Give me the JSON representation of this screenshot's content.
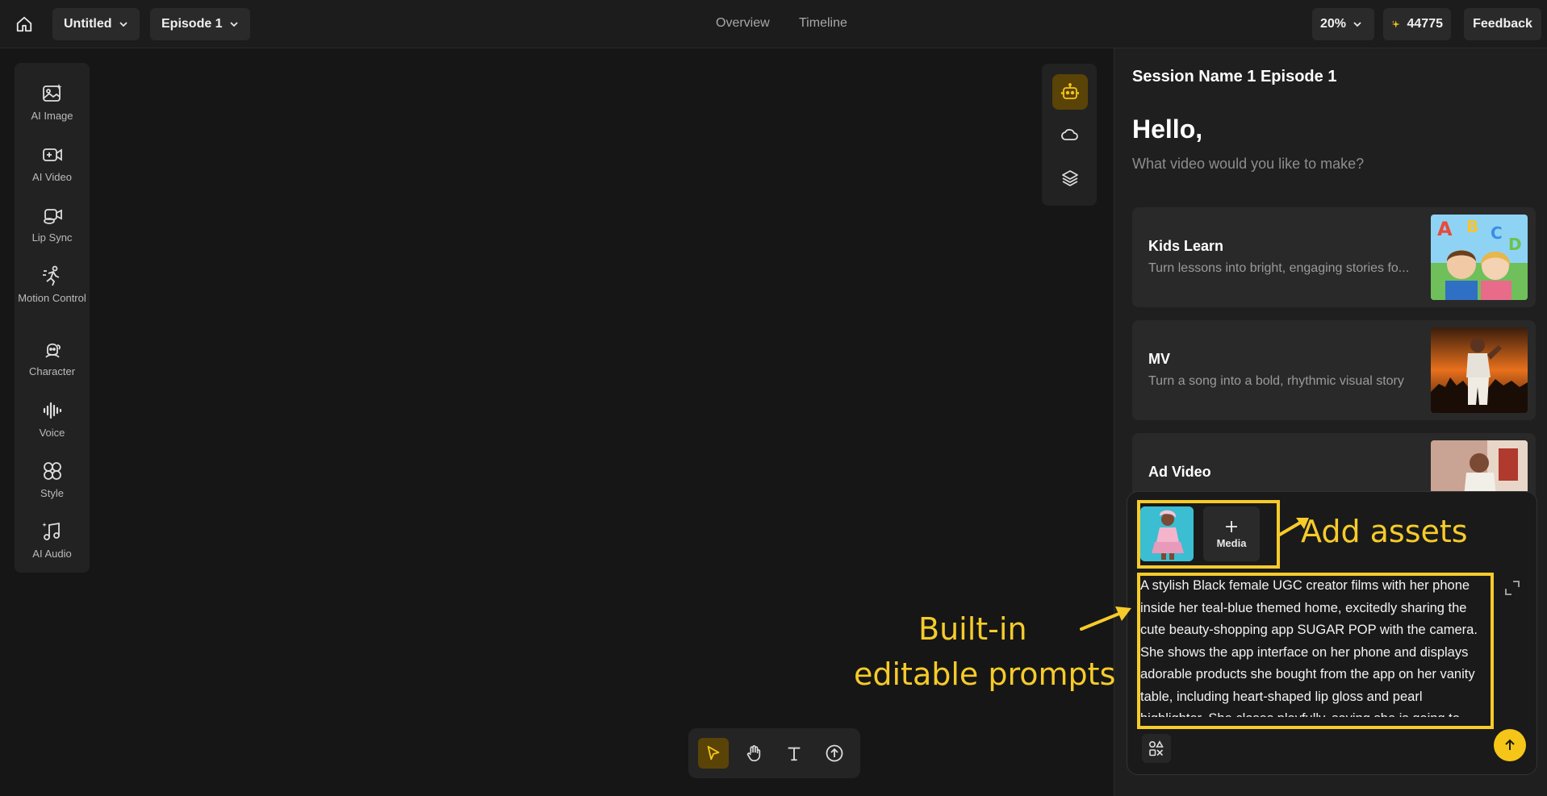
{
  "header": {
    "project": "Untitled",
    "episode": "Episode 1",
    "nav": [
      "Overview",
      "Timeline"
    ],
    "zoom": "20%",
    "credits": "44775",
    "feedback": "Feedback"
  },
  "rail": {
    "items": [
      {
        "label": "AI Image",
        "icon": "ai-image-icon"
      },
      {
        "label": "AI Video",
        "icon": "ai-video-icon"
      },
      {
        "label": "Lip Sync",
        "icon": "lip-sync-icon"
      },
      {
        "label": "Motion Control",
        "icon": "motion-control-icon"
      },
      {
        "label": "Character",
        "icon": "character-icon"
      },
      {
        "label": "Voice",
        "icon": "voice-icon"
      },
      {
        "label": "Style",
        "icon": "style-icon"
      },
      {
        "label": "AI Audio",
        "icon": "ai-audio-icon"
      }
    ]
  },
  "panel": {
    "session_title": "Session Name 1 Episode 1",
    "greeting": "Hello,",
    "subtitle": "What video would you like to make?",
    "cards": [
      {
        "title": "Kids Learn",
        "desc": "Turn lessons into bright, engaging stories fo..."
      },
      {
        "title": "MV",
        "desc": "Turn a song into a bold, rhythmic visual story"
      },
      {
        "title": "Ad Video",
        "desc": ""
      }
    ]
  },
  "composer": {
    "media_label": "Media",
    "prompt": "A stylish Black female UGC creator films with her phone inside her teal-blue themed home, excitedly sharing the cute beauty-shopping app SUGAR POP with the camera. She shows the app interface on her phone and displays adorable products she bought from the app on her vanity table, including heart-shaped lip gloss and pearl highlighter. She closes playfully, saying she is going to"
  },
  "annotations": {
    "add_assets": "Add assets",
    "built_in_line1": "Built-in",
    "built_in_line2": "editable prompts"
  },
  "colors": {
    "accent": "#f5c518",
    "annotation": "#f6cb2a",
    "active_bg": "#5a4306"
  }
}
